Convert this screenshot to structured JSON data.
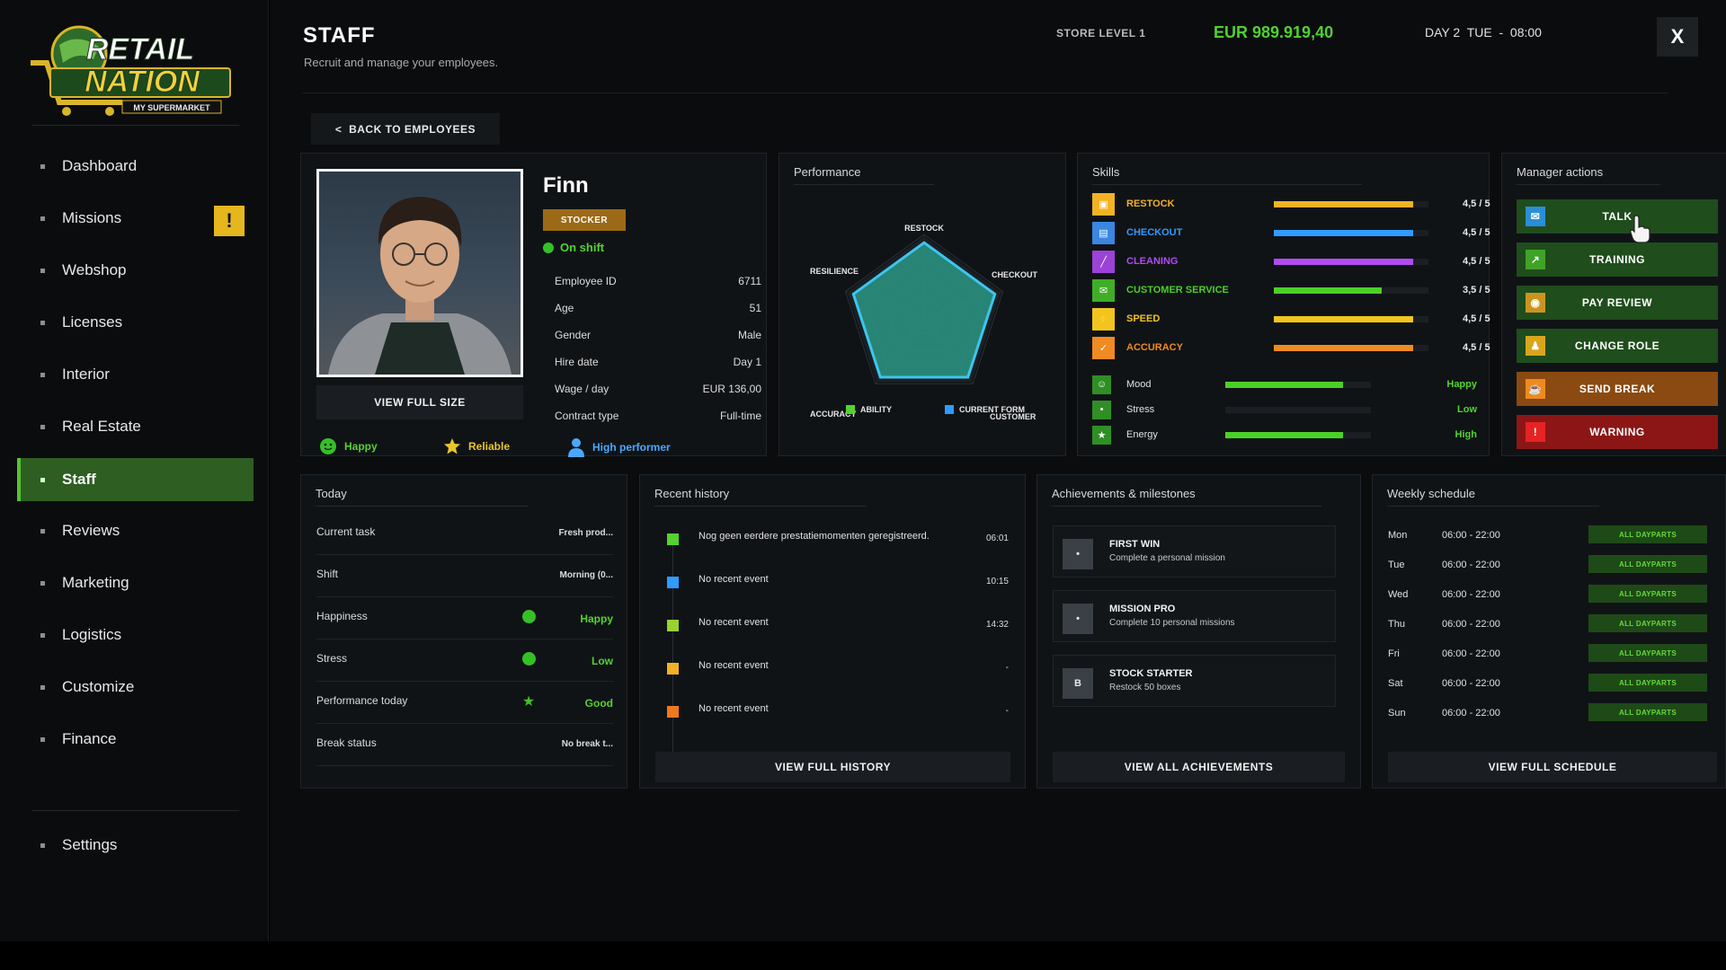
{
  "app": {
    "logo_line1": "RETAIL",
    "logo_line2": "NATION",
    "logo_tag": "MY SUPERMARKET"
  },
  "sidebar": {
    "items": [
      {
        "label": "Dashboard"
      },
      {
        "label": "Missions",
        "alert": "!"
      },
      {
        "label": "Webshop"
      },
      {
        "label": "Licenses"
      },
      {
        "label": "Interior"
      },
      {
        "label": "Real Estate"
      },
      {
        "label": "Staff",
        "active": true
      },
      {
        "label": "Reviews"
      },
      {
        "label": "Marketing"
      },
      {
        "label": "Logistics"
      },
      {
        "label": "Customize"
      },
      {
        "label": "Finance"
      }
    ],
    "settings": "Settings"
  },
  "header": {
    "title": "STAFF",
    "subtitle": "Recruit and manage your employees.",
    "store_level": "STORE LEVEL 1",
    "money": "EUR 989.919,40",
    "day": "DAY 2  TUE  -  08:00",
    "close": "X"
  },
  "back_button": "<  BACK TO EMPLOYEES",
  "profile": {
    "name": "Finn",
    "role": "STOCKER",
    "status": "On shift",
    "view_full_size": "VIEW FULL SIZE",
    "info": [
      {
        "label": "Employee ID",
        "value": "6711"
      },
      {
        "label": "Age",
        "value": "51"
      },
      {
        "label": "Gender",
        "value": "Male"
      },
      {
        "label": "Hire date",
        "value": "Day 1"
      },
      {
        "label": "Wage / day",
        "value": "EUR 136,00"
      },
      {
        "label": "Contract type",
        "value": "Full-time"
      }
    ],
    "traits": [
      {
        "label": "Happy",
        "color": "#54d22f"
      },
      {
        "label": "Reliable",
        "color": "#e8c52a"
      },
      {
        "label": "High performer",
        "color": "#4aa8ff"
      }
    ]
  },
  "performance": {
    "title": "Performance",
    "labels": [
      "RESTOCK",
      "CHECKOUT",
      "CUSTOMER",
      "ACCURACY",
      "RESILIENCE"
    ],
    "legend": [
      {
        "label": "ABILITY",
        "color": "#54d22f"
      },
      {
        "label": "CURRENT FORM",
        "color": "#2f9bff"
      }
    ],
    "ability": [
      4.5,
      4.5,
      4.5,
      4.5,
      4.5
    ],
    "current_form": [
      4.3,
      4.3,
      4.3,
      4.3,
      4.3
    ],
    "max": 5
  },
  "skills": {
    "title": "Skills",
    "items": [
      {
        "label": "RESTOCK",
        "value": "4,5 / 5",
        "level": 0.9,
        "color": "#f2b224",
        "icon_color": "#f2b224",
        "icon": "box-icon"
      },
      {
        "label": "CHECKOUT",
        "value": "4,5 / 5",
        "level": 0.9,
        "color": "#2f9bff",
        "icon_color": "#3a86e0",
        "icon": "register-icon"
      },
      {
        "label": "CLEANING",
        "value": "4,5 / 5",
        "level": 0.9,
        "color": "#b04cf0",
        "icon_color": "#9b43d8",
        "icon": "broom-icon"
      },
      {
        "label": "CUSTOMER SERVICE",
        "value": "3,5 / 5",
        "level": 0.7,
        "color": "#4bd028",
        "icon_color": "#3fae26",
        "icon": "chat-icon"
      },
      {
        "label": "SPEED",
        "value": "4,5 / 5",
        "level": 0.9,
        "color": "#f2c51e",
        "icon_color": "#f2c51e",
        "icon": "bolt-icon"
      },
      {
        "label": "ACCURACY",
        "value": "4,5 / 5",
        "level": 0.9,
        "color": "#f08a22",
        "icon_color": "#f08a22",
        "icon": "check-icon"
      }
    ],
    "states": [
      {
        "label": "Mood",
        "value": "Happy",
        "level": 0.81,
        "icon": "smile-icon"
      },
      {
        "label": "Stress",
        "value": "Low",
        "level": 0.0,
        "icon": "neutral-face-icon"
      },
      {
        "label": "Energy",
        "value": "High",
        "level": 0.81,
        "icon": "star-icon"
      }
    ]
  },
  "manager_actions": {
    "title": "Manager actions",
    "buttons": [
      {
        "label": "TALK",
        "bg": "#1f4d1c",
        "icon_color": "#2a8ed8",
        "icon": "chat-icon"
      },
      {
        "label": "TRAINING",
        "bg": "#1f4d1c",
        "icon_color": "#3fa328",
        "icon": "chart-icon"
      },
      {
        "label": "PAY REVIEW",
        "bg": "#1f4d1c",
        "icon_color": "#c9951e",
        "icon": "coin-icon"
      },
      {
        "label": "CHANGE ROLE",
        "bg": "#1f4d1c",
        "icon_color": "#d9a51c",
        "icon": "person-icon"
      },
      {
        "label": "SEND BREAK",
        "bg": "#8a4a12",
        "icon_color": "#ef8a1e",
        "icon": "coffee-icon"
      },
      {
        "label": "WARNING",
        "bg": "#8c1616",
        "icon_color": "#e62323",
        "icon": "warning-icon"
      }
    ]
  },
  "today": {
    "title": "Today",
    "rows": [
      {
        "label": "Current task",
        "value": "Fresh prod..."
      },
      {
        "label": "Shift",
        "value": "Morning (0..."
      },
      {
        "label": "Happiness",
        "value": "Happy",
        "icon": "smile-icon",
        "green": true
      },
      {
        "label": "Stress",
        "value": "Low",
        "icon": "neutral-face-icon",
        "green": true
      },
      {
        "label": "Performance today",
        "value": "Good",
        "icon": "star-icon",
        "green": true
      },
      {
        "label": "Break status",
        "value": "No break t..."
      }
    ]
  },
  "history": {
    "title": "Recent history",
    "items": [
      {
        "text": "Nog geen eerdere prestatiemomenten geregistreerd.",
        "time": "06:01",
        "color": "#54d22f"
      },
      {
        "text": "No recent event",
        "time": "10:15",
        "color": "#2f9bff"
      },
      {
        "text": "No recent event",
        "time": "14:32",
        "color": "#9ad22f"
      },
      {
        "text": "No recent event",
        "time": "-",
        "color": "#f2b224"
      },
      {
        "text": "No recent event",
        "time": "-",
        "color": "#f0781e"
      }
    ],
    "button": "VIEW FULL HISTORY"
  },
  "achievements": {
    "title": "Achievements & milestones",
    "items": [
      {
        "icon": "•",
        "title": "FIRST WIN",
        "desc": "Complete a personal mission"
      },
      {
        "icon": "•",
        "title": "MISSION PRO",
        "desc": "Complete 10 personal missions"
      },
      {
        "icon": "B",
        "title": "STOCK STARTER",
        "desc": "Restock 50 boxes"
      }
    ],
    "button": "VIEW ALL ACHIEVEMENTS"
  },
  "schedule": {
    "title": "Weekly schedule",
    "rows": [
      {
        "day": "Mon",
        "time": "06:00 - 22:00",
        "tag": "ALL DAYPARTS"
      },
      {
        "day": "Tue",
        "time": "06:00 - 22:00",
        "tag": "ALL DAYPARTS"
      },
      {
        "day": "Wed",
        "time": "06:00 - 22:00",
        "tag": "ALL DAYPARTS"
      },
      {
        "day": "Thu",
        "time": "06:00 - 22:00",
        "tag": "ALL DAYPARTS"
      },
      {
        "day": "Fri",
        "time": "06:00 - 22:00",
        "tag": "ALL DAYPARTS"
      },
      {
        "day": "Sat",
        "time": "06:00 - 22:00",
        "tag": "ALL DAYPARTS"
      },
      {
        "day": "Sun",
        "time": "06:00 - 22:00",
        "tag": "ALL DAYPARTS"
      }
    ],
    "button": "VIEW FULL SCHEDULE"
  }
}
